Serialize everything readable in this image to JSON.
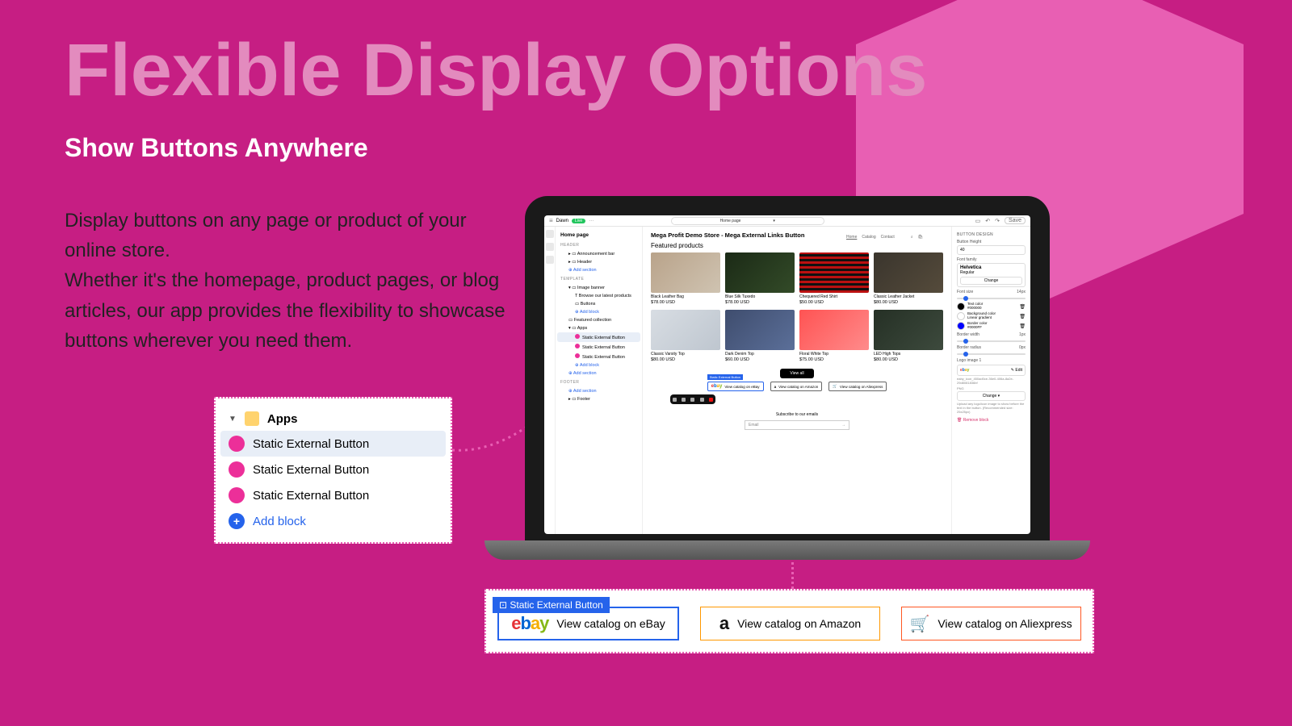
{
  "hero": {
    "title": "Flexible Display Options",
    "subtitle": "Show Buttons Anywhere",
    "body": "Display buttons on any page or product of your online store.\nWhether it's the homepage, product pages, or blog articles, our app provides the flexibility to showcase buttons wherever you need them."
  },
  "apps_callout": {
    "heading": "Apps",
    "items": [
      "Static External Button",
      "Static External Button",
      "Static External Button"
    ],
    "add": "Add block"
  },
  "screen": {
    "topbar": {
      "breadcrumb": "Dawn",
      "status": "Live",
      "center": "Home page",
      "save": "Save"
    },
    "sidebar": {
      "title": "Home page",
      "sections": {
        "header_label": "HEADER",
        "header_items": [
          "Announcement bar",
          "Header",
          "Add section"
        ],
        "template_label": "TEMPLATE",
        "template_items": [
          "Image banner",
          "Browse our latest products",
          "Buttons",
          "Add block",
          "Featured collection",
          "Apps",
          "Static External Button",
          "Static External Button",
          "Static External Button",
          "Add block",
          "Add section"
        ],
        "footer_label": "FOOTER",
        "footer_items": [
          "Add section",
          "Footer"
        ]
      }
    },
    "main": {
      "store_title": "Mega Profit Demo Store - Mega External Links Button",
      "nav": [
        "Home",
        "Catalog",
        "Contact"
      ],
      "featured_title": "Featured products",
      "products": [
        {
          "name": "Black Leather Bag",
          "price": "$78.00 USD"
        },
        {
          "name": "Blue Silk Tuxedo",
          "price": "$78.00 USD"
        },
        {
          "name": "Chequered Red Shirt",
          "price": "$50.00 USD"
        },
        {
          "name": "Classic Leather Jacket",
          "price": "$80.00 USD"
        },
        {
          "name": "Classic Varsity Top",
          "price": "$80.00 USD"
        },
        {
          "name": "Dark Denim Top",
          "price": "$60.00 USD"
        },
        {
          "name": "Floral White Top",
          "price": "$75.00 USD"
        },
        {
          "name": "LED High Tops",
          "price": "$80.00 USD"
        }
      ],
      "view_all": "View all",
      "cta_selected_label": "Static External Button",
      "ctas": [
        "View catalog on eBay",
        "View catalog on Amazon",
        "View catalog on Aliexpress"
      ],
      "subscribe": "Subscribe to our emails",
      "email_placeholder": "Email"
    },
    "right": {
      "section": "BUTTON DESIGN",
      "height_label": "Button Height",
      "height_val": "40",
      "font_family_label": "Font family",
      "font_family": "Helvetica",
      "font_style": "Regular",
      "change": "Change",
      "font_size_label": "Font size",
      "font_size_val": "14px",
      "text_color_label": "Text color",
      "text_color": "#000000",
      "bg_label": "Background color",
      "bg_sub": "Linear gradient",
      "border_color_label": "Border color",
      "border_color": "#0000FF",
      "border_width_label": "Border width",
      "border_width_val": "1px",
      "border_radius_label": "Border radius",
      "border_radius_val": "0px",
      "logo_label": "Logo image 1",
      "logo_edit": "Edit",
      "logo_filename": "eaby_icon_450ad0ce-36e0-406a-8a2e-29d8081836bf",
      "logo_type": "PNG",
      "change2": "Change",
      "hint": "Upload any logo/icon image to show before the text in the button. (Recommended size: 25x25px)",
      "remove": "Remove block"
    }
  },
  "bottom": {
    "tag": "Static External Button",
    "buttons": [
      {
        "label": "View catalog on eBay"
      },
      {
        "label": "View catalog on Amazon"
      },
      {
        "label": "View catalog on Aliexpress"
      }
    ]
  }
}
